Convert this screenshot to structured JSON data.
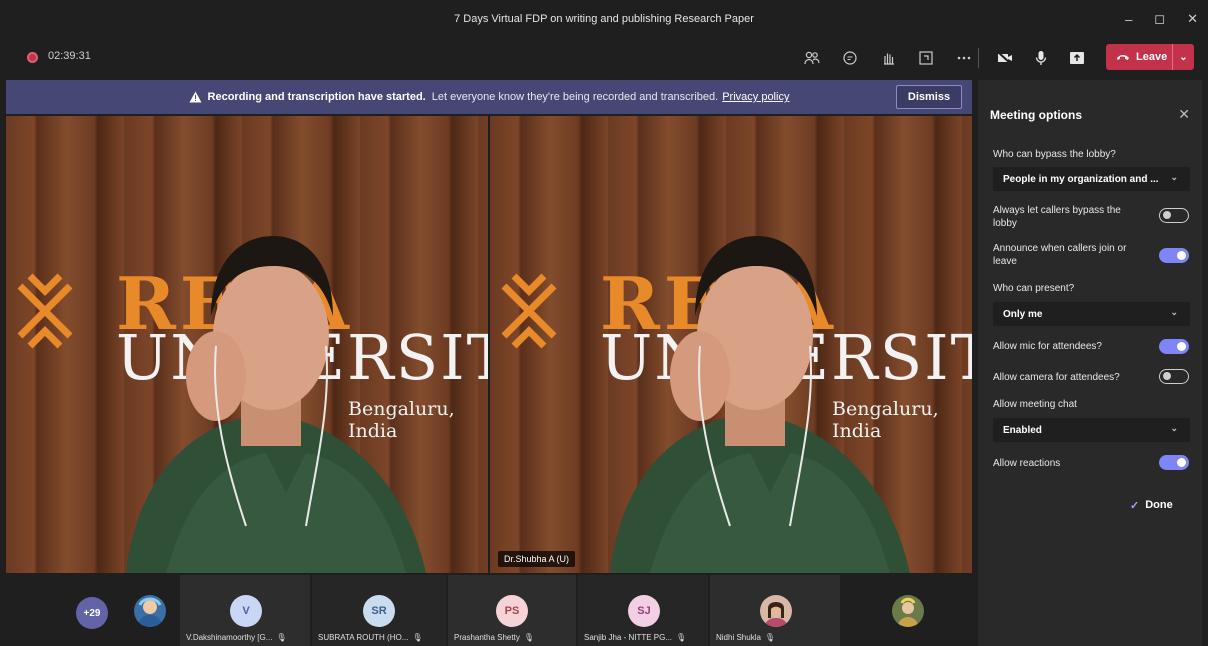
{
  "window": {
    "title": "7 Days Virtual FDP on writing and publishing Research Paper",
    "controls": [
      "–",
      "◻",
      "✕"
    ]
  },
  "toolbar": {
    "timer": "02:39:31",
    "leave_label": "Leave",
    "icons": [
      "people-icon",
      "chat-icon",
      "raise-hand-icon",
      "rooms-icon",
      "more-icon",
      "camera-off-icon",
      "mic-icon",
      "share-icon"
    ]
  },
  "banner": {
    "bold": "Recording and transcription have started.",
    "text": "Let everyone know they're being recorded and transcribed.",
    "link": "Privacy policy",
    "dismiss": "Dismiss"
  },
  "video": {
    "logo_top": "REVA",
    "logo_mid": "UNIVERSITY",
    "logo_city": "Bengaluru, India",
    "name_tag": "Dr.Shubha A (U)",
    "name_icon": "🎙"
  },
  "participants": {
    "overflow": "+29",
    "tiles": [
      {
        "initials": "V",
        "name": "V.Dakshinamoorthy [G...",
        "color": "#c9d6f5",
        "text_color": "#4a5fa0"
      },
      {
        "initials": "SR",
        "name": "SUBRATA ROUTH (HO...",
        "color": "#c9dcf0",
        "text_color": "#3a5f8a"
      },
      {
        "initials": "PS",
        "name": "Prashantha Shetty",
        "color": "#f5d3d6",
        "text_color": "#a64553"
      },
      {
        "initials": "SJ",
        "name": "Sanjib Jha - NITTE PG...",
        "color": "#f3cfe5",
        "text_color": "#9a3f78"
      },
      {
        "initials": "",
        "name": "Nidhi Shukla",
        "color": "#d9b8a8",
        "text_color": "#000"
      }
    ],
    "mic_glyph": "🎙"
  },
  "panel": {
    "title": "Meeting options",
    "close": "✕",
    "lobby_label": "Who can bypass the lobby?",
    "lobby_value": "People in my organization and ...",
    "callers_label": "Always let callers bypass the lobby",
    "announce_label": "Announce when callers join or leave",
    "present_label": "Who can present?",
    "present_value": "Only me",
    "mic_label": "Allow mic for attendees?",
    "camera_label": "Allow camera for attendees?",
    "chat_label": "Allow meeting chat",
    "chat_value": "Enabled",
    "reactions_label": "Allow reactions",
    "done": "Done",
    "toggles": {
      "callers": false,
      "announce": true,
      "mic": true,
      "camera": false,
      "reactions": true
    }
  }
}
